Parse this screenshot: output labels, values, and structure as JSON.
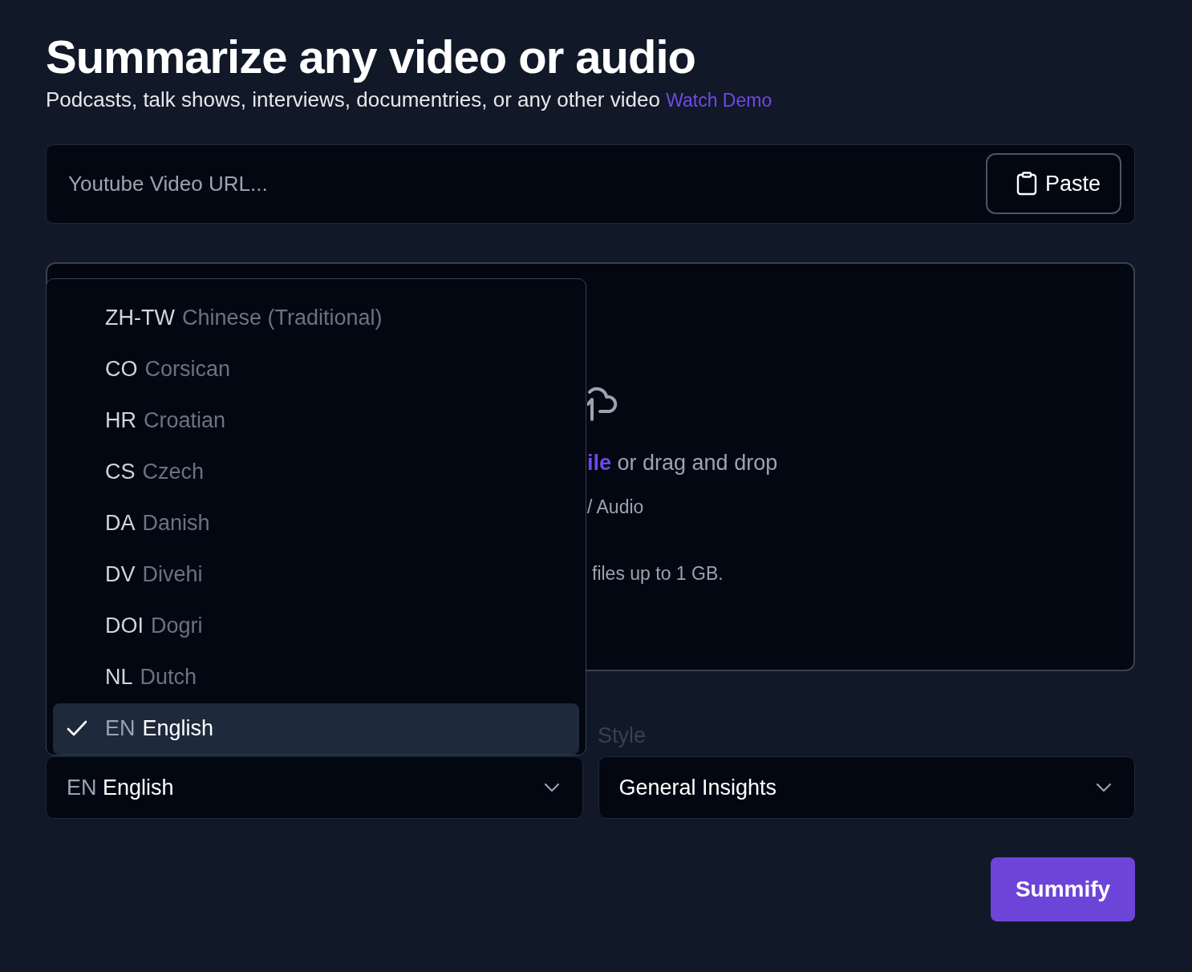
{
  "header": {
    "title": "Summarize any video or audio",
    "subtitle": "Podcasts, talk shows, interviews, documentries, or any other video",
    "demo_link": "Watch Demo"
  },
  "url_input": {
    "placeholder": "Youtube Video URL...",
    "paste_button": "Paste"
  },
  "upload": {
    "prompt_link": "ile",
    "prompt_rest": "or drag and drop",
    "types": "/ Audio",
    "limit": "files up to 1 GB."
  },
  "language_menu": {
    "items": [
      {
        "code": "ZH-TW",
        "name": "Chinese (Traditional)",
        "selected": false
      },
      {
        "code": "CO",
        "name": "Corsican",
        "selected": false
      },
      {
        "code": "HR",
        "name": "Croatian",
        "selected": false
      },
      {
        "code": "CS",
        "name": "Czech",
        "selected": false
      },
      {
        "code": "DA",
        "name": "Danish",
        "selected": false
      },
      {
        "code": "DV",
        "name": "Divehi",
        "selected": false
      },
      {
        "code": "DOI",
        "name": "Dogri",
        "selected": false
      },
      {
        "code": "NL",
        "name": "Dutch",
        "selected": false
      },
      {
        "code": "EN",
        "name": "English",
        "selected": true
      }
    ]
  },
  "style_label": "Style",
  "language_select": {
    "code": "EN",
    "name": "English"
  },
  "style_select": {
    "value": "General Insights"
  },
  "submit_button": "Summify"
}
